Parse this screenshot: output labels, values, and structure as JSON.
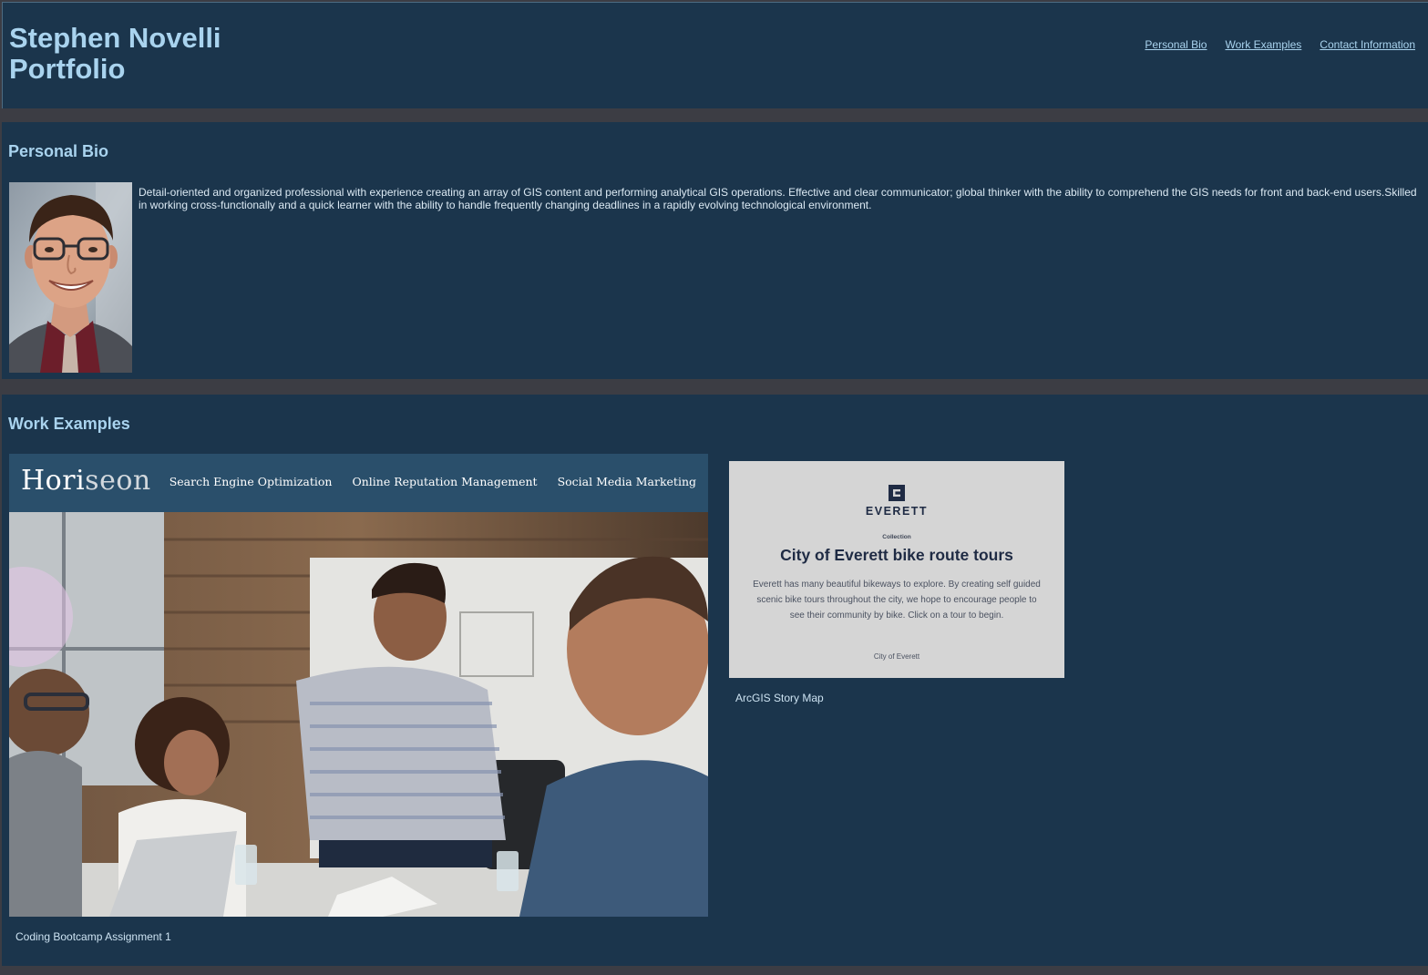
{
  "header": {
    "title_line1": "Stephen Novelli",
    "title_line2": "Portfolio",
    "nav": [
      "Personal Bio",
      "Work Examples",
      "Contact Information"
    ]
  },
  "bio": {
    "heading": "Personal Bio",
    "text": "Detail-oriented and organized professional with experience creating an array of GIS content and performing analytical GIS operations. Effective and clear communicator; global thinker with the ability to comprehend the GIS needs for front and back-end users.Skilled in working cross-functionally and a quick learner with the ability to handle frequently changing deadlines in a rapidly evolving technological environment."
  },
  "work": {
    "heading": "Work Examples",
    "horiseon": {
      "logo_a": "Hori",
      "logo_b": "seon",
      "nav": [
        "Search Engine Optimization",
        "Online Reputation Management",
        "Social Media Marketing"
      ],
      "caption": "Coding Bootcamp Assignment 1"
    },
    "everett": {
      "name": "EVERETT",
      "collection": "Collection",
      "title": "City of Everett bike route tours",
      "description": "Everett has many beautiful bikeways to explore. By creating self guided scenic bike tours throughout the city, we hope to encourage people to see their community by bike. Click on a tour to begin.",
      "org": "City of Everett",
      "caption": "ArcGIS Story Map"
    }
  },
  "colors": {
    "page_bg": "#3c3d44",
    "section_bg": "#1b354c",
    "heading_text": "#a9d3ee",
    "horiseon_bar": "#2a4f6b",
    "everett_card": "#d5d5d5"
  }
}
